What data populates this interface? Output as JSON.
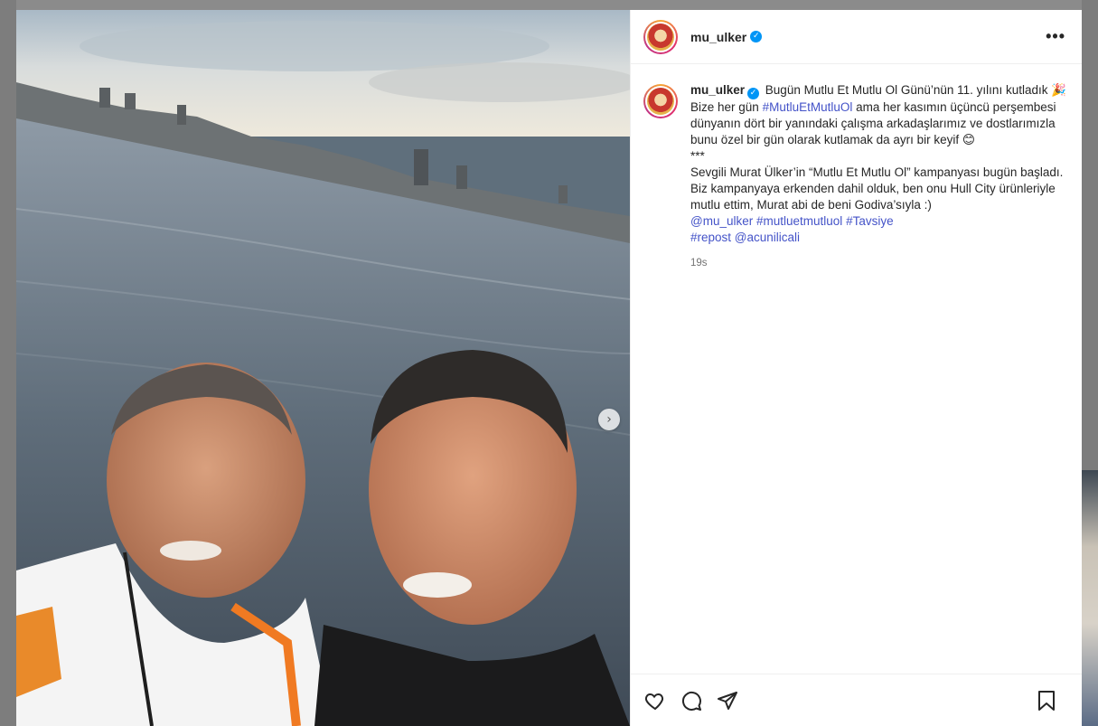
{
  "post": {
    "author": {
      "username": "mu_ulker",
      "verified": true,
      "avatar_icon": "avatar-image"
    },
    "caption": {
      "lines": [
        {
          "type": "text",
          "value": "Bugün Mutlu Et Mutlu Ol Günü’nün 11. yılını kutladık"
        },
        {
          "type": "emoji",
          "value": "🎉"
        },
        {
          "type": "text",
          "value": "Bize her gün "
        },
        {
          "type": "hashtag",
          "value": "#MutluEtMutluOl"
        },
        {
          "type": "text",
          "value": " ama her kasımın üçüncü perşembesi dünyanın dört bir yanındaki çalışma arkadaşlarımız ve dostlarımızla bunu özel bir gün olarak kutlamak da ayrı bir keyif "
        },
        {
          "type": "emoji",
          "value": "😊"
        }
      ],
      "separator": "***",
      "paragraph2": "Sevgili Murat Ülker’in “Mutlu Et Mutlu Ol” kampanyası bugün başladı. Biz kampanyaya erkenden dahil olduk, ben onu Hull City ürünleriyle mutlu ettim, Murat abi de beni Godiva’sıyla :)",
      "tags_line1": [
        "@mu_ulker",
        "#mutluetmutluol",
        "#Tavsiye"
      ],
      "tags_line2": [
        "#repost",
        "@acunilicali"
      ]
    },
    "timestamp": "19s",
    "more_icon": "more-horizontal-icon",
    "actions": {
      "like_icon": "heart-icon",
      "comment_icon": "comment-icon",
      "share_icon": "share-icon",
      "save_icon": "bookmark-icon"
    },
    "media": {
      "description_icon": "photo",
      "next_icon": "chevron-right-icon"
    }
  },
  "colors": {
    "link": "#4453c8",
    "verified": "#0095f6",
    "text": "#262626",
    "muted": "#737373"
  }
}
